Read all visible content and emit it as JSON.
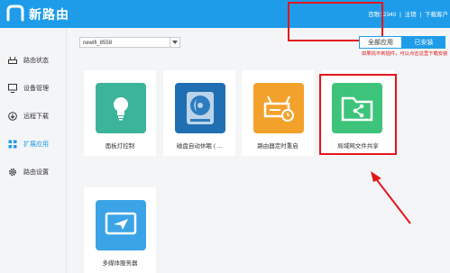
{
  "header": {
    "brand": "新路由",
    "account": "百歌12340",
    "sep": "|",
    "logout": "注销",
    "download": "下载客户"
  },
  "sidebar": {
    "items": [
      {
        "label": "路由状态",
        "icon": "router-icon"
      },
      {
        "label": "设备管理",
        "icon": "monitor-icon"
      },
      {
        "label": "远程下载",
        "icon": "download-icon"
      },
      {
        "label": "扩展应用",
        "icon": "grid-icon",
        "active": true
      },
      {
        "label": "路由设置",
        "icon": "gear-icon"
      }
    ]
  },
  "main": {
    "network_select": "newifi_8558",
    "tabs": {
      "all": "全部应用",
      "installed": "已安装"
    },
    "tip": "如果找不到插件，可以点击这里下载安装",
    "apps": [
      {
        "name": "面板灯控制",
        "icon": "bulb-icon",
        "color": "#3cb49a"
      },
      {
        "name": "磁盘自动休眠 ( ...",
        "icon": "disk-icon",
        "color": "#1f6fb2"
      },
      {
        "name": "路由器定时重启",
        "icon": "router-clock-icon",
        "color": "#f2a12a"
      },
      {
        "name": "局域网文件共享",
        "icon": "folder-share-icon",
        "color": "#3dc47a"
      },
      {
        "name": "多媒体服务器",
        "icon": "media-send-icon",
        "color": "#3ba4e6"
      }
    ]
  },
  "colors": {
    "primary": "#1e9ce9",
    "alert": "#e3161b"
  }
}
